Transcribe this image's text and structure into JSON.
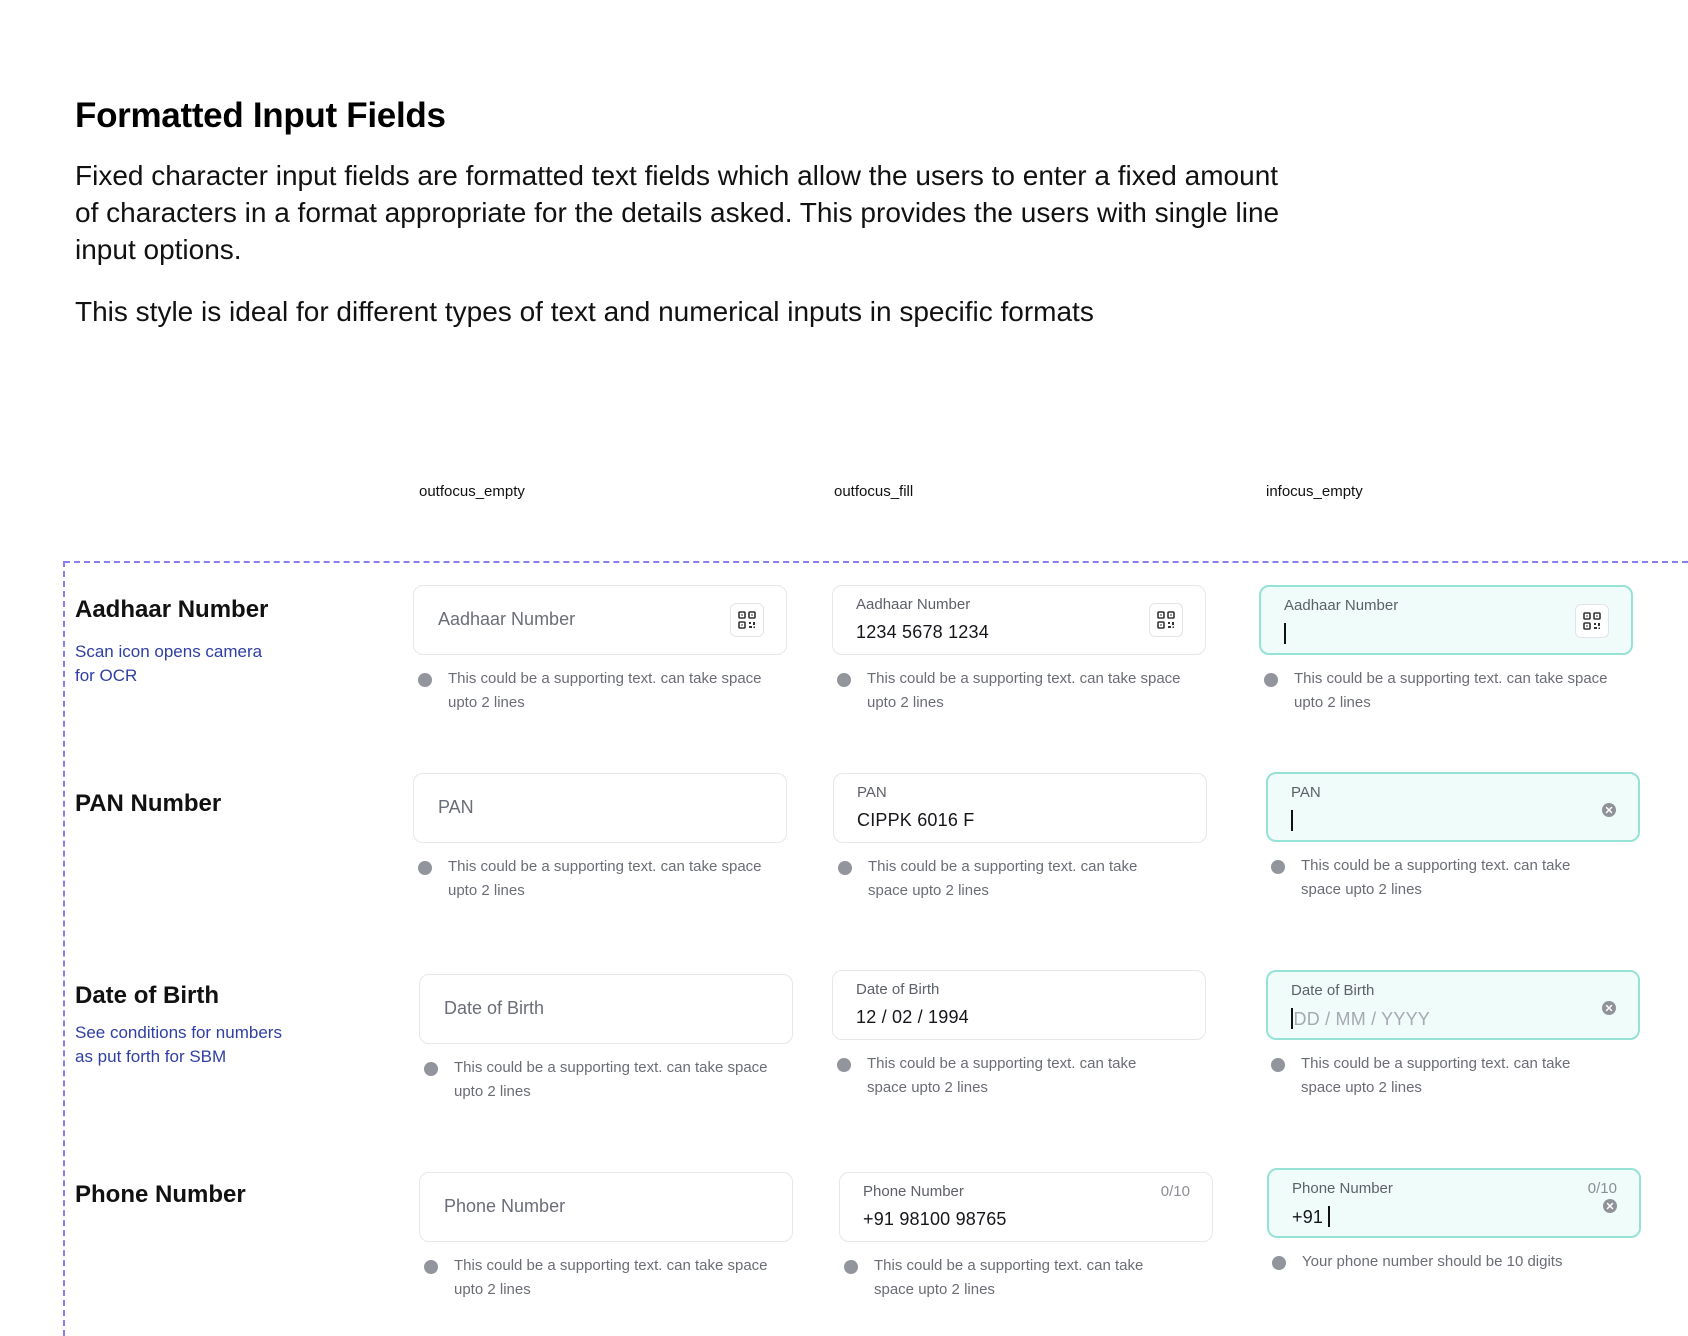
{
  "header": {
    "title": "Formatted Input Fields",
    "description": "Fixed character input fields are formatted text fields which allow the users to enter a fixed amount of characters in a format appropriate for the details asked. This provides the users with single line input options.",
    "description2": "This style is ideal for different types of text and numerical inputs in specific formats"
  },
  "columns": [
    "outfocus_empty",
    "outfocus_fill",
    "infocus_empty"
  ],
  "colors": {
    "guide_dash": "#8a7df0",
    "note_text": "#2f3fa3",
    "focus_border": "#96e2d6",
    "focus_bg": "#effcfa"
  },
  "icons": {
    "scan": "qr-scan-icon",
    "clear": "clear-icon",
    "helper": "info-dot-icon"
  },
  "rows": [
    {
      "title": "Aadhaar Number",
      "note": "Scan icon opens camera for OCR",
      "empty": {
        "placeholder": "Aadhaar Number",
        "helper": "This could be a supporting text. can take space upto 2 lines"
      },
      "fill": {
        "label": "Aadhaar Number",
        "value": "1234 5678 1234",
        "helper": "This could be a supporting text. can take space upto 2 lines"
      },
      "focus": {
        "label": "Aadhaar Number",
        "value": "",
        "helper": "This could be a supporting text. can take space upto 2 lines"
      }
    },
    {
      "title": "PAN Number",
      "note": "",
      "empty": {
        "placeholder": "PAN",
        "helper": "This could be a supporting text. can take space upto 2 lines"
      },
      "fill": {
        "label": "PAN",
        "value": "CIPPK 6016 F",
        "helper": "This could be a supporting text. can take space upto 2 lines"
      },
      "focus": {
        "label": "PAN",
        "value": "",
        "helper": "This could be a supporting text. can take space upto 2 lines"
      }
    },
    {
      "title": "Date of Birth",
      "note": "See conditions for numbers as put forth for SBM",
      "empty": {
        "placeholder": "Date of Birth",
        "helper": "This could be a supporting text. can take space upto 2 lines"
      },
      "fill": {
        "label": "Date of Birth",
        "value": "12 / 02 / 1994",
        "helper": "This could be a supporting text. can take space upto 2 lines"
      },
      "focus": {
        "label": "Date of Birth",
        "value": "DD / MM / YYYY",
        "helper": "This could be a supporting text. can take space upto 2 lines"
      }
    },
    {
      "title": "Phone Number",
      "note": "",
      "empty": {
        "placeholder": "Phone Number",
        "helper": "This could be a supporting text. can take space upto 2 lines"
      },
      "fill": {
        "label": "Phone Number",
        "counter": "0/10",
        "value": "+91 98100 98765",
        "helper": "This could be a supporting text. can take space upto 2 lines"
      },
      "focus": {
        "label": "Phone Number",
        "counter": "0/10",
        "value": "+91 ",
        "helper": "Your phone number should be 10 digits"
      }
    }
  ]
}
